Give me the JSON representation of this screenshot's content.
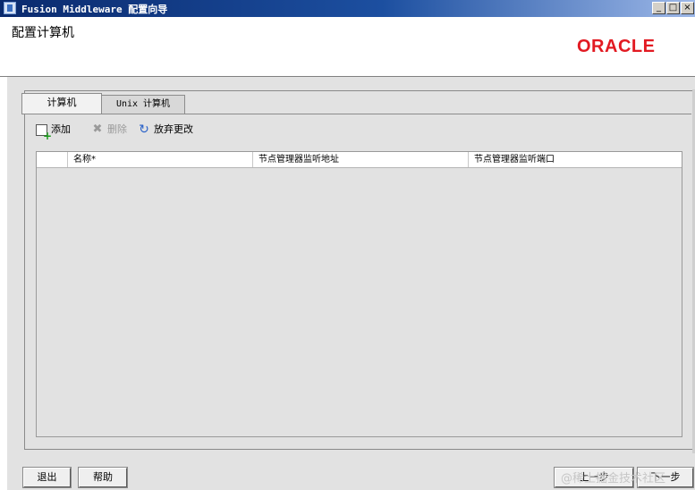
{
  "window": {
    "title": "Fusion Middleware 配置向导",
    "min": "_",
    "max": "□",
    "close": "×"
  },
  "header": {
    "title": "配置计算机",
    "logo": "ORACLE"
  },
  "tabs": [
    {
      "label": "计算机",
      "selected": true
    },
    {
      "label": "Unix 计算机",
      "selected": false
    }
  ],
  "toolbar": {
    "add_label": "添加",
    "delete_label": "删除",
    "revert_label": "放弃更改"
  },
  "table": {
    "columns": [
      "名称*",
      "节点管理器监听地址",
      "节点管理器监听端口"
    ],
    "rows": []
  },
  "footer": {
    "exit_label": "退出",
    "help_label": "帮助",
    "back_label": "上一步",
    "next_label": "下一步"
  },
  "watermark": "@稀土掘金技术社区",
  "icons": {
    "add": "add-row-icon",
    "delete": "delete-x-icon",
    "revert": "revert-arrow-icon"
  },
  "colors": {
    "logo": "#e21a22",
    "titlebar": "#0a2a6e",
    "panel": "#e2e2e2"
  }
}
